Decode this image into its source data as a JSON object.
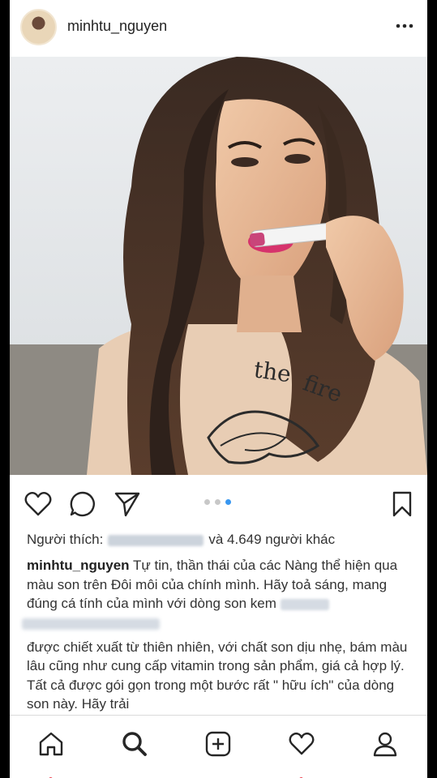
{
  "post": {
    "username": "minhtu_nguyen",
    "more_label": "More options"
  },
  "photo": {
    "description_icon": "photo",
    "shirt_text_1": "the",
    "shirt_text_2": "fire"
  },
  "actions": {
    "like_icon": "heart-icon",
    "comment_icon": "comment-icon",
    "share_icon": "send-icon",
    "save_icon": "bookmark-icon",
    "carousel_count": 3,
    "carousel_active": 3
  },
  "likes": {
    "prefix": "Người thích:",
    "suffix": "và 4.649 người khác"
  },
  "caption": {
    "author": "minhtu_nguyen",
    "text_1": " Tự tin, thần thái của các Nàng thể hiện qua màu son trên Đôi môi của chính mình. Hãy toả sáng, mang đúng cá tính của mình với dòng son kem ",
    "text_2": "được  chiết xuất từ thiên nhiên, với chất son dịu nhẹ, bám màu lâu cũng như cung cấp vitamin trong sản phẩm, giá cả hợp lý. Tất cả được gói gọn trong một bước rất \" hữu ích\" của dòng son này. Hãy trải"
  },
  "tabbar": {
    "home": "home-icon",
    "search": "search-icon",
    "add": "add-post-icon",
    "activity": "activity-icon",
    "profile": "profile-icon"
  },
  "colors": {
    "accent_blue": "#3897f0",
    "notification_red": "#ed4956"
  }
}
